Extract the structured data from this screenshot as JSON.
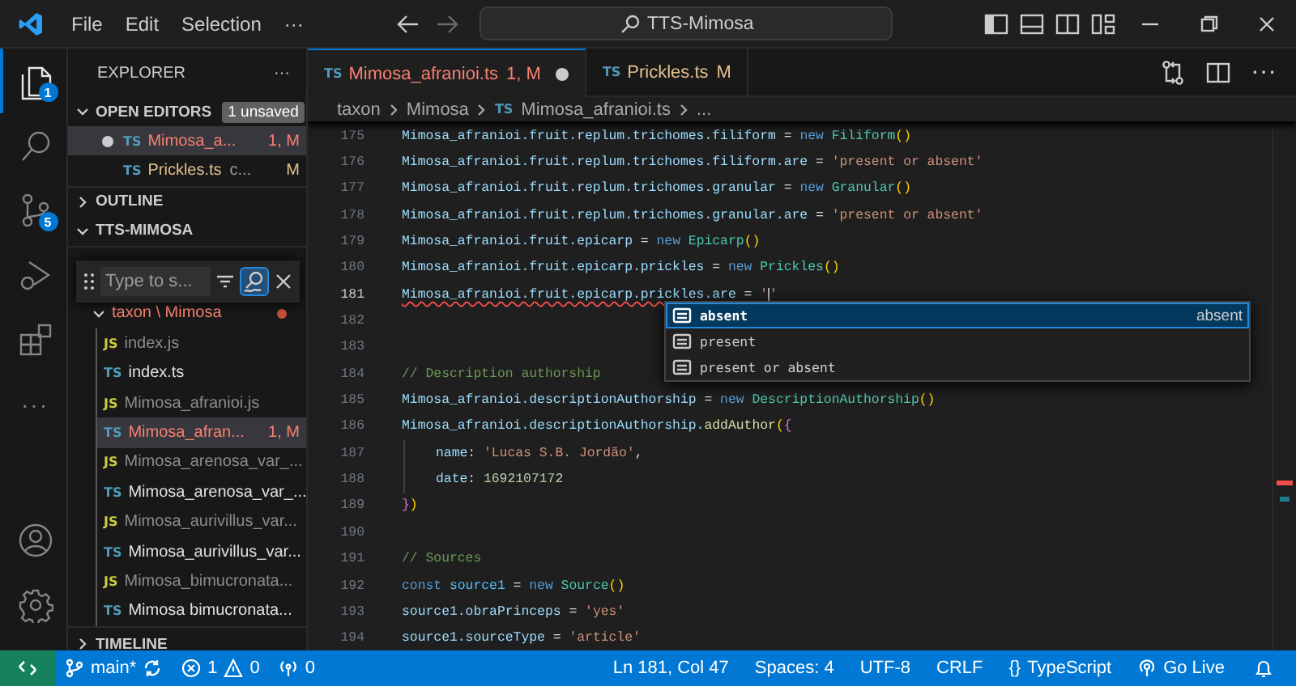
{
  "titlebar": {
    "menu": [
      "File",
      "Edit",
      "Selection",
      "···"
    ],
    "search": "TTS-Mimosa"
  },
  "activity_bar": {
    "items": [
      {
        "kind": "files",
        "selected": true,
        "badge": "1"
      },
      {
        "kind": "search",
        "selected": false
      },
      {
        "kind": "scm",
        "selected": false,
        "badge": "5"
      },
      {
        "kind": "debug",
        "selected": false
      },
      {
        "kind": "extensions",
        "selected": false
      },
      {
        "kind": "more",
        "selected": false,
        "text": "···"
      }
    ],
    "bottom": [
      {
        "kind": "account"
      },
      {
        "kind": "settings"
      }
    ]
  },
  "sidebar": {
    "title": "EXPLORER",
    "more": "···",
    "open_editors": {
      "title": "OPEN EDITORS",
      "expanded": true,
      "badge": "1 unsaved",
      "items": [
        {
          "icon_text": "TS",
          "name": "Mimosa_a...",
          "status": "1, M",
          "kind": "error",
          "dirty": true,
          "selected": true
        },
        {
          "icon_text": "TS",
          "name": "Prickles.ts",
          "description": "c...",
          "status": "M",
          "kind": "modified",
          "dirty": false,
          "selected": false
        }
      ]
    },
    "outline": {
      "title": "OUTLINE",
      "expanded": false
    },
    "folder": {
      "title": "TTS-MIMOSA",
      "expanded": true,
      "find": {
        "placeholder": "Type to s...",
        "fuzzy": true
      },
      "tree": [
        {
          "kind": "error",
          "name": "taxon \\ Mimosa",
          "expanded": true,
          "children": [
            {
              "kind": "ignored",
              "icon_text": "JS",
              "name": "index.js",
              "selected": false
            },
            {
              "kind": "normal",
              "icon_text": "TS",
              "name": "index.ts",
              "selected": false
            },
            {
              "kind": "ignored",
              "icon_text": "JS",
              "name": "Mimosa_afranioi.js",
              "selected": false
            },
            {
              "kind": "error",
              "icon_text": "TS",
              "name": "Mimosa_afran...",
              "status": "1, M",
              "selected": true
            },
            {
              "kind": "ignored",
              "icon_text": "JS",
              "name": "Mimosa_arenosa_var_...",
              "selected": false
            },
            {
              "kind": "normal",
              "icon_text": "TS",
              "name": "Mimosa_arenosa_var_...",
              "selected": false
            },
            {
              "kind": "ignored",
              "icon_text": "JS",
              "name": "Mimosa_aurivillus_var...",
              "selected": false
            },
            {
              "kind": "normal",
              "icon_text": "TS",
              "name": "Mimosa_aurivillus_var...",
              "selected": false
            },
            {
              "kind": "ignored",
              "icon_text": "JS",
              "name": "Mimosa_bimucronata...",
              "selected": false
            },
            {
              "kind": "normal",
              "icon_text": "TS",
              "name": "Mimosa bimucronata...",
              "selected": false
            }
          ]
        }
      ]
    },
    "timeline": {
      "title": "TIMELINE",
      "expanded": false
    }
  },
  "tabs": [
    {
      "icon_text": "TS",
      "label": "Mimosa_afranioi.ts",
      "status": "1, M",
      "kind": "error",
      "dirty": true,
      "selected": true
    },
    {
      "icon_text": "TS",
      "label": "Prickles.ts",
      "status": "M",
      "kind": "modified",
      "dirty": false,
      "selected": false
    }
  ],
  "breadcrumbs": [
    "taxon",
    "Mimosa",
    {
      "icon_text": "TS",
      "label": "Mimosa_afranioi.ts"
    },
    "..."
  ],
  "code": [
    {
      "number": "175",
      "current": false,
      "tokens": [
        {
          "kind": "var",
          "text": "Mimosa_afranioi.fruit.replum.trichomes.filiform"
        },
        {
          "kind": "op",
          "text": " = "
        },
        {
          "kind": "kw",
          "text": "new "
        },
        {
          "kind": "cls",
          "text": "Filiform"
        },
        {
          "kind": "paren",
          "text": "()"
        }
      ]
    },
    {
      "number": "176",
      "current": false,
      "tokens": [
        {
          "kind": "var",
          "text": "Mimosa_afranioi.fruit.replum.trichomes.filiform.are"
        },
        {
          "kind": "op",
          "text": " = "
        },
        {
          "kind": "str",
          "text": "'present or absent'"
        }
      ]
    },
    {
      "number": "177",
      "current": false,
      "tokens": [
        {
          "kind": "var",
          "text": "Mimosa_afranioi.fruit.replum.trichomes.granular"
        },
        {
          "kind": "op",
          "text": " = "
        },
        {
          "kind": "kw",
          "text": "new "
        },
        {
          "kind": "cls",
          "text": "Granular"
        },
        {
          "kind": "paren",
          "text": "()"
        }
      ]
    },
    {
      "number": "178",
      "current": false,
      "tokens": [
        {
          "kind": "var",
          "text": "Mimosa_afranioi.fruit.replum.trichomes.granular.are"
        },
        {
          "kind": "op",
          "text": " = "
        },
        {
          "kind": "str",
          "text": "'present or absent'"
        }
      ]
    },
    {
      "number": "179",
      "current": false,
      "tokens": [
        {
          "kind": "var",
          "text": "Mimosa_afranioi.fruit.epicarp"
        },
        {
          "kind": "op",
          "text": " = "
        },
        {
          "kind": "kw",
          "text": "new "
        },
        {
          "kind": "cls",
          "text": "Epicarp"
        },
        {
          "kind": "paren",
          "text": "()"
        }
      ]
    },
    {
      "number": "180",
      "current": false,
      "tokens": [
        {
          "kind": "var",
          "text": "Mimosa_afranioi.fruit.epicarp.prickles"
        },
        {
          "kind": "op",
          "text": " = "
        },
        {
          "kind": "kw",
          "text": "new "
        },
        {
          "kind": "cls",
          "text": "Prickles"
        },
        {
          "kind": "paren",
          "text": "()"
        }
      ]
    },
    {
      "number": "181",
      "current": true,
      "tokens": [
        {
          "kind": "var",
          "text": "Mimosa_afranioi.fruit.epicarp.prickles.are",
          "error": true
        },
        {
          "kind": "op",
          "text": " = "
        },
        {
          "kind": "str",
          "text": "'"
        },
        {
          "kind": "str",
          "text": "'",
          "caret": true
        }
      ]
    },
    {
      "number": "182",
      "current": false
    },
    {
      "number": "183",
      "current": false
    },
    {
      "number": "184",
      "current": false,
      "tokens": [
        {
          "kind": "comment",
          "text": "// Description authorship"
        }
      ]
    },
    {
      "number": "185",
      "current": false,
      "tokens": [
        {
          "kind": "var",
          "text": "Mimosa_afranioi.descriptionAuthorship"
        },
        {
          "kind": "op",
          "text": " = "
        },
        {
          "kind": "kw",
          "text": "new "
        },
        {
          "kind": "cls",
          "text": "DescriptionAuthorship"
        },
        {
          "kind": "paren",
          "text": "()"
        }
      ]
    },
    {
      "number": "186",
      "current": false,
      "tokens": [
        {
          "kind": "var",
          "text": "Mimosa_afranioi.descriptionAuthorship."
        },
        {
          "kind": "fn",
          "text": "addAuthor"
        },
        {
          "kind": "paren",
          "text": "("
        },
        {
          "kind": "brace",
          "text": "{"
        }
      ]
    },
    {
      "number": "187",
      "current": false,
      "indent": true,
      "tokens": [
        {
          "kind": "var",
          "text": "name"
        },
        {
          "kind": "op",
          "text": ": "
        },
        {
          "kind": "str",
          "text": "'Lucas S.B. Jordão'"
        },
        {
          "kind": "op",
          "text": ","
        }
      ]
    },
    {
      "number": "188",
      "current": false,
      "indent": true,
      "tokens": [
        {
          "kind": "var",
          "text": "date"
        },
        {
          "kind": "op",
          "text": ": "
        },
        {
          "kind": "num",
          "text": "1692107172"
        }
      ]
    },
    {
      "number": "189",
      "current": false,
      "tokens": [
        {
          "kind": "brace",
          "text": "}"
        },
        {
          "kind": "paren",
          "text": ")"
        }
      ]
    },
    {
      "number": "190",
      "current": false
    },
    {
      "number": "191",
      "current": false,
      "tokens": [
        {
          "kind": "comment",
          "text": "// Sources"
        }
      ]
    },
    {
      "number": "192",
      "current": false,
      "tokens": [
        {
          "kind": "kw",
          "text": "const "
        },
        {
          "kind": "const",
          "text": "source1"
        },
        {
          "kind": "op",
          "text": " = "
        },
        {
          "kind": "kw",
          "text": "new "
        },
        {
          "kind": "cls",
          "text": "Source"
        },
        {
          "kind": "paren",
          "text": "()"
        }
      ]
    },
    {
      "number": "193",
      "current": false,
      "tokens": [
        {
          "kind": "var",
          "text": "source1.obraPrinceps"
        },
        {
          "kind": "op",
          "text": " = "
        },
        {
          "kind": "str",
          "text": "'yes'"
        }
      ]
    },
    {
      "number": "194",
      "current": false,
      "tokens": [
        {
          "kind": "var",
          "text": "source1.sourceType"
        },
        {
          "kind": "op",
          "text": " = "
        },
        {
          "kind": "str",
          "text": "'article'"
        }
      ]
    }
  ],
  "suggestions": [
    {
      "label": "absent",
      "detail": "absent",
      "selected": true
    },
    {
      "label": "present",
      "selected": false
    },
    {
      "label": "present or absent",
      "selected": false
    }
  ],
  "status_bar": {
    "branch": "main*",
    "errors": "1",
    "warnings": "0",
    "ports": "0",
    "right": [
      {
        "kind": "plain",
        "label": "Ln 181, Col 47"
      },
      {
        "kind": "plain",
        "label": "Spaces: 4"
      },
      {
        "kind": "plain",
        "label": "UTF-8"
      },
      {
        "kind": "plain",
        "label": "CRLF"
      },
      {
        "kind": "language",
        "icon_text": "{}",
        "label": "TypeScript"
      },
      {
        "kind": "live",
        "label": "Go Live"
      }
    ]
  }
}
